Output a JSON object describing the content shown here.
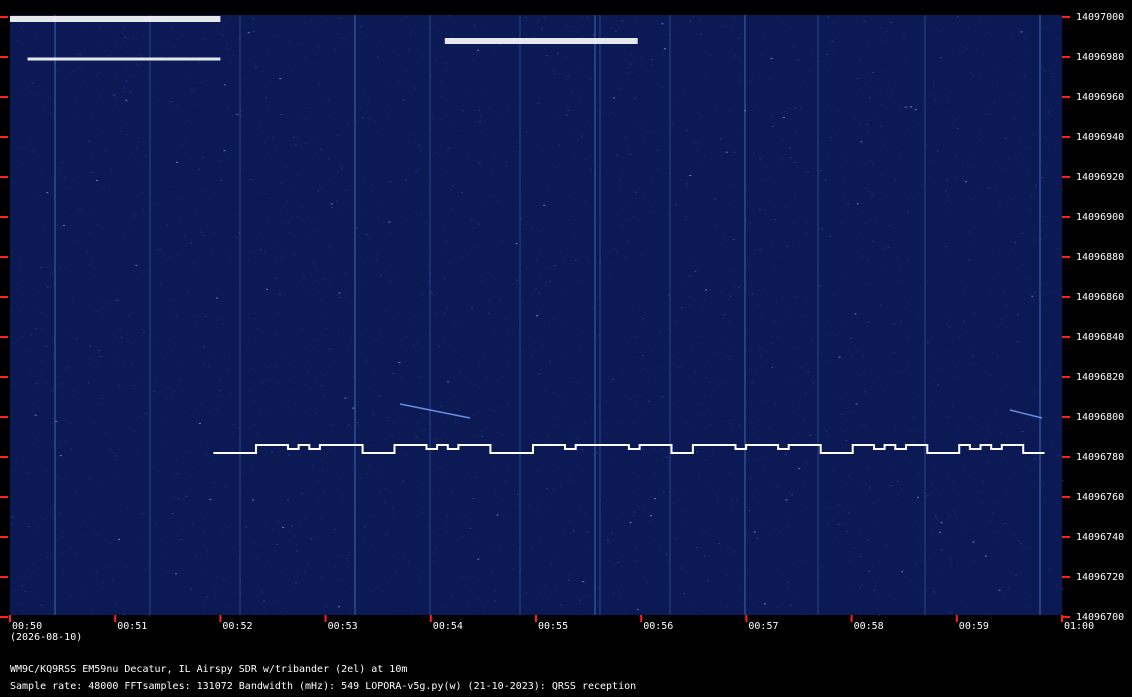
{
  "chart_data": {
    "type": "heatmap",
    "title": "",
    "xlabel": "",
    "ylabel": "",
    "x_ticks": [
      "00:50",
      "00:51",
      "00:52",
      "00:53",
      "00:54",
      "00:55",
      "00:56",
      "00:57",
      "00:58",
      "00:59",
      "01:00"
    ],
    "x_subtitle": "(2026-08-10)",
    "y_ticks": [
      14097000,
      14096980,
      14096960,
      14096940,
      14096920,
      14096900,
      14096880,
      14096860,
      14096840,
      14096820,
      14096800,
      14096780,
      14096760,
      14096740,
      14096720,
      14096700
    ],
    "ylim": [
      14096700,
      14097000
    ],
    "xlim_minutes": [
      0,
      10
    ],
    "colormap": "dark-blue to white",
    "signals": [
      {
        "name": "QRSS FSK trace",
        "freq_low": 14096781,
        "freq_high": 14096785,
        "start": "00:51:56",
        "end": "00:59:50"
      },
      {
        "name": "strong carrier A",
        "freq": 14096998,
        "start": "00:50:00",
        "end": "00:52:00"
      },
      {
        "name": "carrier A sideband",
        "freq": 14096978,
        "start": "00:50:10",
        "end": "00:52:00"
      },
      {
        "name": "strong carrier B",
        "freq": 14096987,
        "start": "00:54:08",
        "end": "00:55:58"
      }
    ]
  },
  "footer": {
    "line1": "WM9C/KQ9RSS EM59nu Decatur, IL  Airspy SDR w/tribander (2el) at 10m",
    "line2": "Sample rate: 48000    FFTsamples: 131072    Bandwidth (mHz): 549          LOPORA-v5g.py(w) (21-10-2023): QRSS reception"
  },
  "colors": {
    "background": "#000000",
    "waterfall": "#0b1a55",
    "tick": "#ff2020",
    "trace": "#ffffff"
  }
}
